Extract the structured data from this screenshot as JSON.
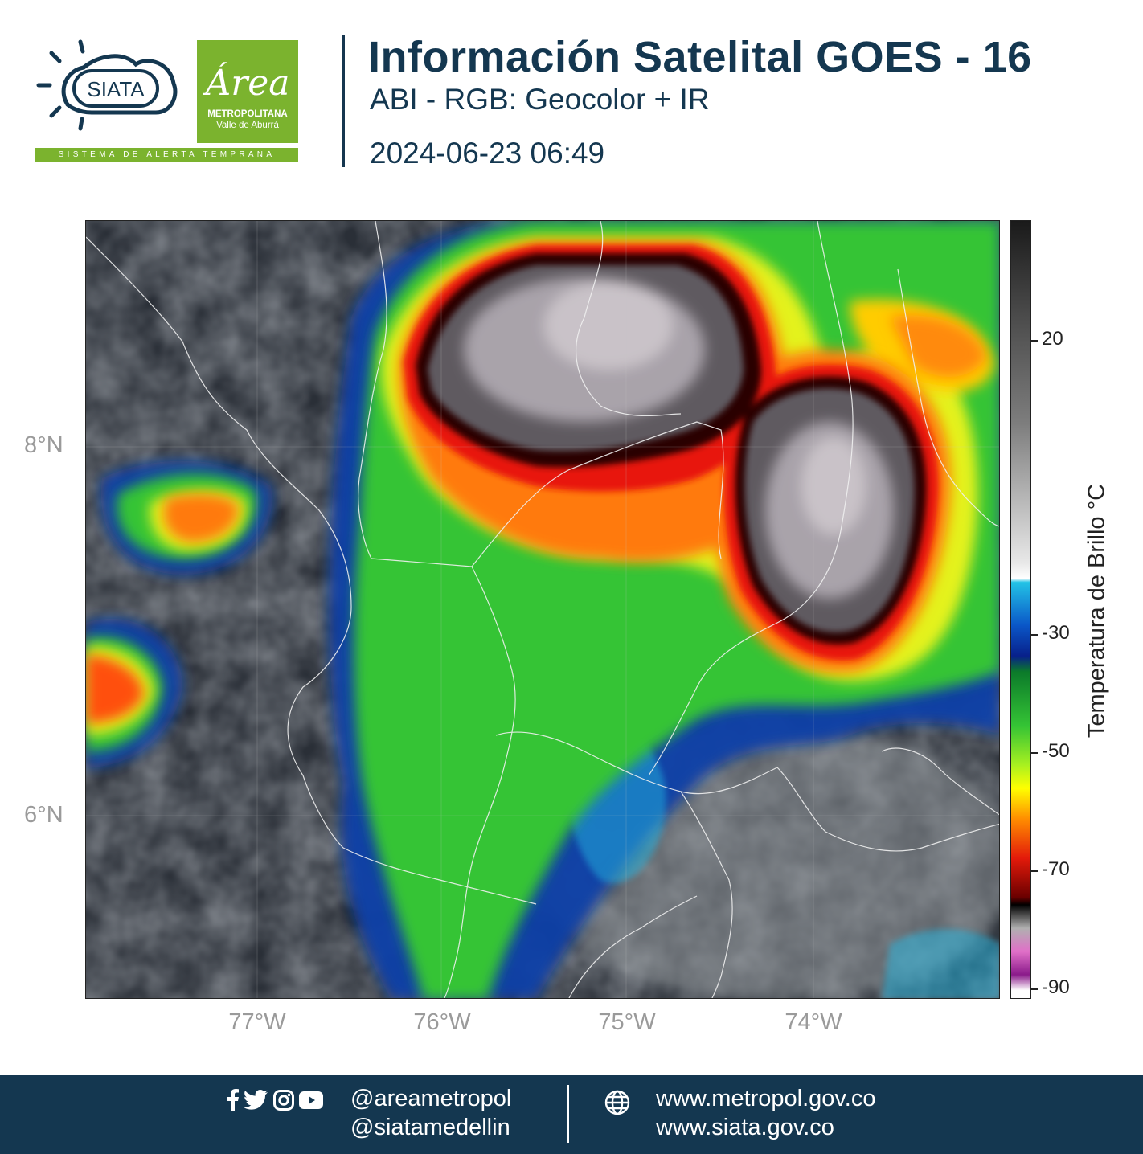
{
  "header": {
    "title": "Información Satelital GOES - 16",
    "subtitle": "ABI - RGB: Geocolor + IR",
    "datetime": "2024-06-23 06:49",
    "siata_logo_text": "SIATA",
    "siata_tagline": "SISTEMA DE ALERTA TEMPRANA",
    "area_logo_script": "Área",
    "area_logo_line1": "METROPOLITANA",
    "area_logo_line2": "Valle de Aburrá"
  },
  "map": {
    "lat_labels": [
      "8°N",
      "6°N"
    ],
    "lon_labels": [
      "77°W",
      "76°W",
      "75°W",
      "74°W"
    ],
    "colorbar": {
      "title": "Temperatura de Brillo °C",
      "ticks": [
        "20",
        "-30",
        "-50",
        "-70",
        "-90"
      ],
      "colors": [
        "#1a1a1a",
        "#4a4a4a",
        "#7d7d7d",
        "#b8b8b8",
        "#e8e8e8",
        "#ffffff",
        "#23c3e6",
        "#0a57c8",
        "#08208a",
        "#0b7a2a",
        "#35c435",
        "#a8f020",
        "#ffff00",
        "#ff8c00",
        "#e31a0a",
        "#6b0000",
        "#000000",
        "#b0b0b0",
        "#e070c8",
        "#8a1a8a",
        "#ffffff"
      ]
    }
  },
  "footer": {
    "handle1": "@areametropol",
    "handle2": "@siatamedellin",
    "url1": "www.metropol.gov.co",
    "url2": "www.siata.gov.co",
    "icons": [
      "facebook-icon",
      "twitter-icon",
      "instagram-icon",
      "youtube-icon",
      "globe-icon"
    ]
  }
}
